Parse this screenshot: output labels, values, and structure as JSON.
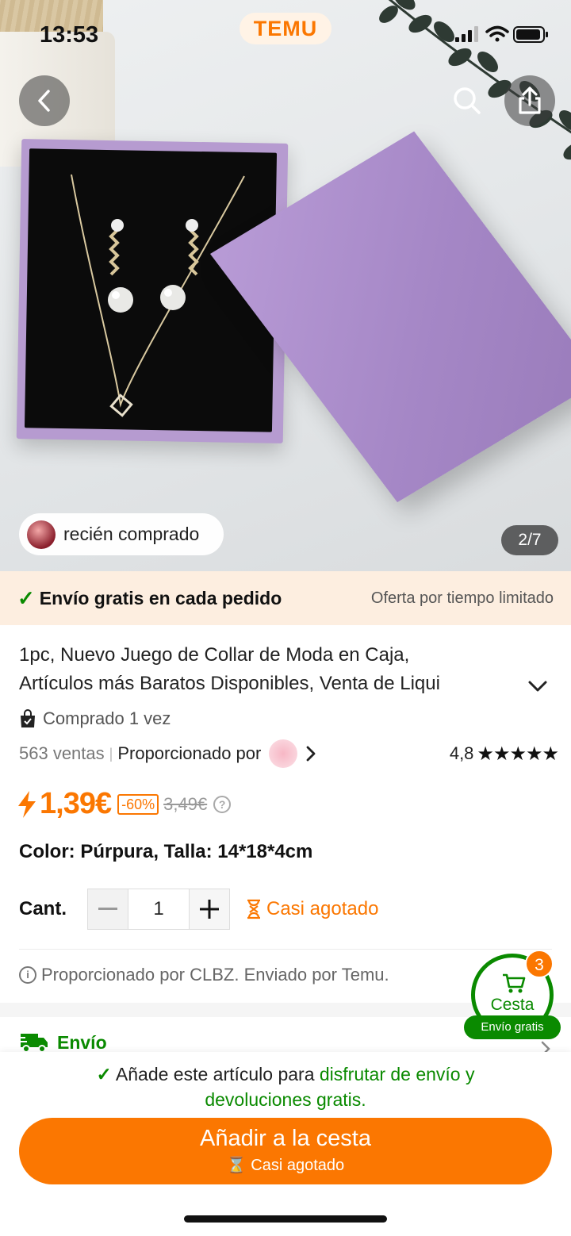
{
  "status_bar": {
    "time": "13:53",
    "brand": "TEMU"
  },
  "gallery": {
    "recent_label": "recién comprado",
    "counter": "2/7"
  },
  "banner": {
    "free_shipping": "Envío gratis en cada pedido",
    "limited_offer": "Oferta por tiempo limitado"
  },
  "product": {
    "title_line1": "1pc, Nuevo Juego de Collar de Moda en Caja,",
    "title_line2": "Artículos más Baratos Disponibles, Venta de Liqui",
    "bought_count": "Comprado 1 vez",
    "sales": "563 ventas",
    "provided_by": "Proporcionado por",
    "rating": "4,8",
    "stars": "★★★★★",
    "price": "1,39€",
    "discount": "-60%",
    "old_price": "3,49€",
    "variant": "Color: Púrpura, Talla: 14*18*4cm",
    "qty_label": "Cant.",
    "qty_value": "1",
    "stock_status": "Casi agotado",
    "seller_note": "Proporcionado por CLBZ. Enviado por Temu."
  },
  "shipping": {
    "label": "Envío"
  },
  "cart": {
    "count": "3",
    "label": "Cesta",
    "free": "Envío gratis"
  },
  "bottom": {
    "promo_prefix": "Añade este artículo para ",
    "promo_green1": "disfrutar de envío y",
    "promo_green2": "devoluciones gratis.",
    "add_button": "Añadir a la cesta",
    "add_sub": "Casi agotado"
  },
  "colors": {
    "accent": "#fb7701",
    "green": "#0a8a00",
    "banner_bg": "#fdeee0"
  },
  "icons": [
    "back-icon",
    "search-icon",
    "share-icon",
    "signal-icon",
    "wifi-icon",
    "battery-icon",
    "check-icon",
    "bag-icon",
    "chevron-down-icon",
    "chevron-right-icon",
    "bolt-icon",
    "help-icon",
    "minus-icon",
    "plus-icon",
    "hourglass-icon",
    "info-icon",
    "truck-icon",
    "cart-icon"
  ]
}
